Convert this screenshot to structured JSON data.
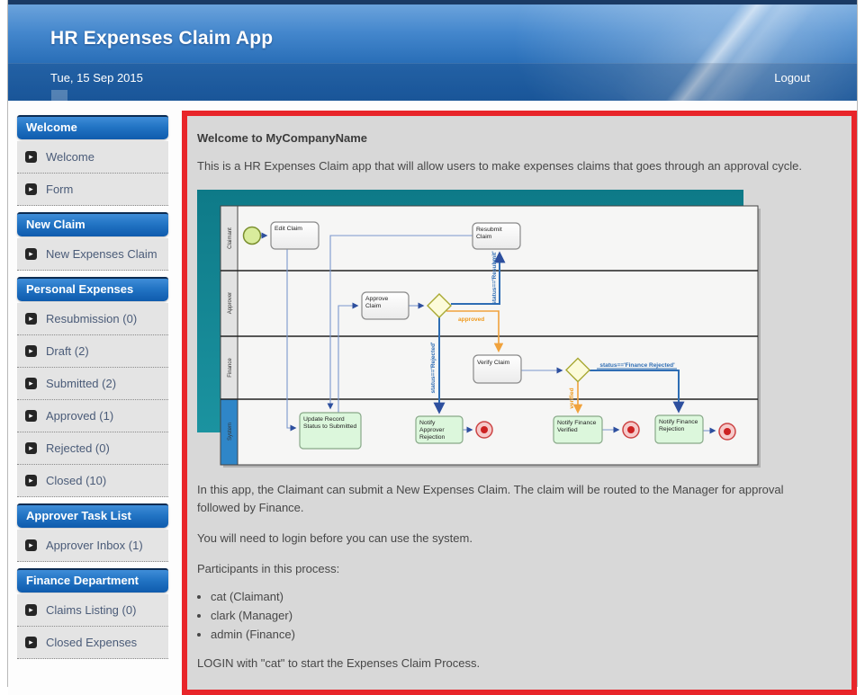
{
  "header": {
    "title": "HR Expenses Claim App",
    "date": "Tue, 15 Sep 2015",
    "logout_label": "Logout"
  },
  "sidebar": {
    "sections": [
      {
        "title": "Welcome",
        "items": [
          "Welcome",
          "Form"
        ]
      },
      {
        "title": "New Claim",
        "items": [
          "New Expenses Claim"
        ]
      },
      {
        "title": "Personal Expenses",
        "items": [
          "Resubmission (0)",
          "Draft (2)",
          "Submitted (2)",
          "Approved (1)",
          "Rejected (0)",
          "Closed (10)"
        ]
      },
      {
        "title": "Approver Task List",
        "items": [
          "Approver Inbox (1)"
        ]
      },
      {
        "title": "Finance Department",
        "items": [
          "Claims Listing (0)",
          "Closed Expenses"
        ]
      }
    ]
  },
  "main": {
    "heading": "Welcome to MyCompanyName",
    "intro": "This is a HR Expenses Claim app that will allow users to make expenses claims that goes through an approval cycle.",
    "para_routing": "In this app, the Claimant can submit a New Expenses Claim. The claim will be routed to the Manager for approval followed by Finance.",
    "para_login": "You will need to login before you can use the system.",
    "para_participants": "Participants in this process:",
    "participants": [
      "cat (Claimant)",
      "clark (Manager)",
      "admin (Finance)"
    ],
    "para_start": "LOGIN with \"cat\" to start the Expenses Claim Process."
  },
  "diagram": {
    "lanes": [
      "Claimant",
      "Approver",
      "Finance",
      "System"
    ],
    "nodes": {
      "edit_claim": [
        "Edit Claim"
      ],
      "resubmit_claim": [
        "Resubmit",
        "Claim"
      ],
      "approve_claim": [
        "Approve",
        "Claim"
      ],
      "verify_claim": [
        "Verify Claim"
      ],
      "update_record": [
        "Update Record",
        "Status to Submitted"
      ],
      "notify_approver_rejection": [
        "Notify",
        "Approver",
        "Rejection"
      ],
      "notify_finance_verified": [
        "Notify Finance",
        "Verified"
      ],
      "notify_finance_rejection": [
        "Notify Finance",
        "Rejection"
      ]
    },
    "edges": {
      "resubmit": "status=='Resubmit'",
      "rejected": "status=='Rejected'",
      "approved": "approved",
      "verified": "verified",
      "finance_rejected": "status=='Finance Rejected'"
    },
    "colors": {
      "teal": "#12808e",
      "system_lane": "#2f86c8",
      "flow_blue": "#2e6db4",
      "flow_orange": "#f0a23c",
      "accent_red": "#e8252a"
    }
  }
}
